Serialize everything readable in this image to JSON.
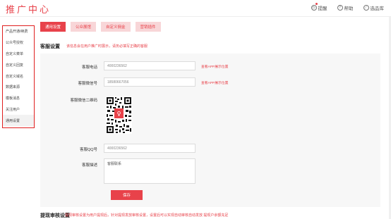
{
  "header": {
    "logo": "推广中心",
    "actions": [
      {
        "label": "提醒",
        "icon": "clock-icon"
      },
      {
        "label": "帮助",
        "icon": "help-icon"
      },
      {
        "label": "选品库",
        "icon": "library-icon"
      }
    ]
  },
  "sidebar": {
    "items": [
      {
        "label": "产品开通/续费"
      },
      {
        "label": "公众号授权"
      },
      {
        "label": "自定义菜单"
      },
      {
        "label": "自定义回复"
      },
      {
        "label": "自定义域名"
      },
      {
        "label": "数据来源"
      },
      {
        "label": "模板消息"
      },
      {
        "label": "关注用户"
      },
      {
        "label": "通用设置"
      }
    ],
    "active_index": 8
  },
  "tabs": [
    "通用设置",
    "公众展馆",
    "自定义佣金",
    "营销插件"
  ],
  "section": {
    "title": "客服设置",
    "note": "该信息会在用户推广时展示，请务必填写正确的客服"
  },
  "form": {
    "phone_label": "客服电话",
    "phone_value": "4000236562",
    "phone_link": "查看APP展示位置",
    "wechat_label": "客服微信号",
    "wechat_value": "18580667056",
    "wechat_link": "查看APP展示位置",
    "qr_label": "客服微信二维码",
    "qq_label": "客服QQ号",
    "qq_value": "4000236562",
    "desc_label": "客服描述",
    "desc_value": "客服联系",
    "save_label": "保存"
  },
  "footer": {
    "title": "提现审核设置",
    "note": "提现审核设置为用户提现后，针对提现发放审核设置，设置后可以实现自动审核自动发放 提现户余额充足"
  },
  "colors": {
    "accent": "#e8424a",
    "tab_inactive_bg": "#f8d6d8",
    "panel_bg": "#f7f7f7",
    "highlight_border": "#e02020"
  }
}
